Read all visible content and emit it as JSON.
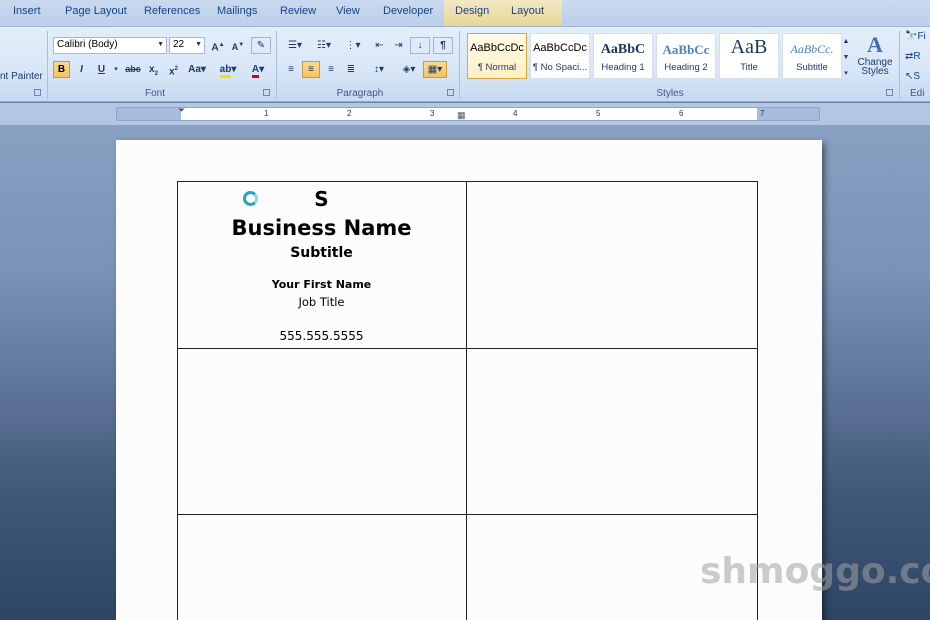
{
  "tabs": [
    "Insert",
    "Page Layout",
    "References",
    "Mailings",
    "Review",
    "View",
    "Developer",
    "Design",
    "Layout"
  ],
  "clipboard": {
    "format_painter_label": "nt Painter"
  },
  "font": {
    "name": "Calibri (Body)",
    "size": "22",
    "group_label": "Font"
  },
  "paragraph": {
    "group_label": "Paragraph"
  },
  "styles": {
    "group_label": "Styles",
    "tiles": [
      {
        "sample": "AaBbCcDc",
        "name": "¶ Normal",
        "selected": true
      },
      {
        "sample": "AaBbCcDc",
        "name": "¶ No Spaci...",
        "selected": false
      },
      {
        "sample": "AaBbC",
        "name": "Heading 1",
        "selected": false
      },
      {
        "sample": "AaBbCc",
        "name": "Heading 2",
        "selected": false
      },
      {
        "sample": "AaB",
        "name": "Title",
        "selected": false
      },
      {
        "sample": "AaBbCc.",
        "name": "Subtitle",
        "selected": false
      }
    ],
    "change_styles_label_1": "Change",
    "change_styles_label_2": "Styles"
  },
  "editing": {
    "group_label": "Edi",
    "find": "Fi",
    "replace": "R",
    "select": "S"
  },
  "ruler": {
    "numbers": [
      "1",
      "2",
      "3",
      "4",
      "5",
      "6",
      "7"
    ]
  },
  "card": {
    "logo_letter": "S",
    "business_name": "Business Name",
    "subtitle": "Subtitle",
    "first_name": "Your First Name",
    "job_title": "Job Title",
    "phone": "555.555.5555"
  },
  "watermark": "shmoggo.co",
  "colors": {
    "ribbon": "#dbe7f7",
    "selected_style_border": "#e2a63a",
    "logo_ring": "#2c9ec1"
  }
}
